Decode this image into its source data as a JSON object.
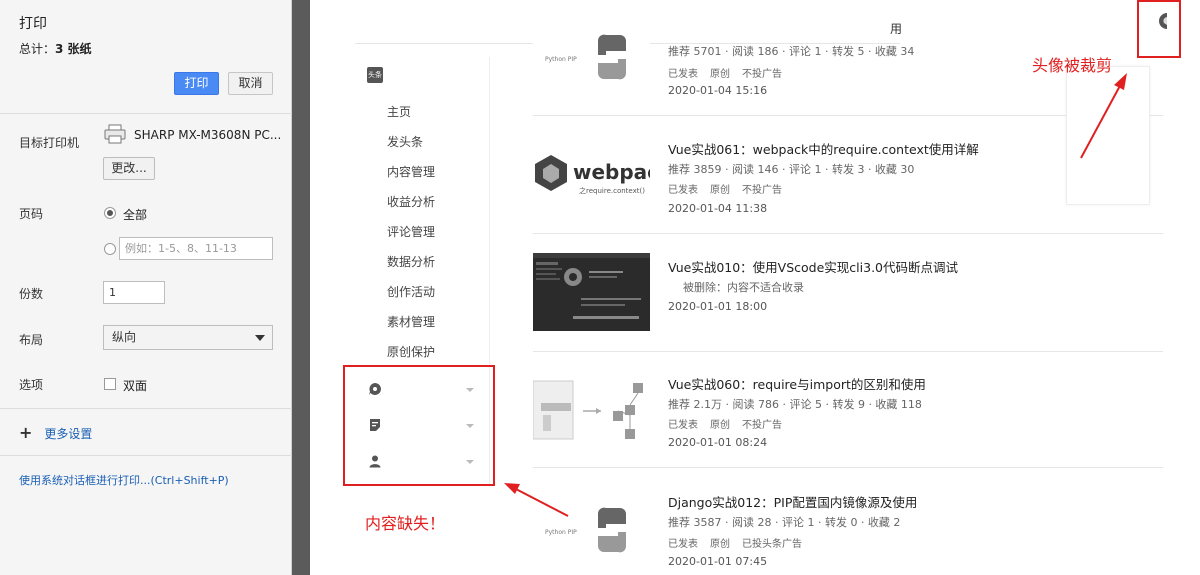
{
  "print_dialog": {
    "title": "打印",
    "total_label": "总计：",
    "total_value": "3 张纸",
    "print_button": "打印",
    "cancel_button": "取消",
    "destination_label": "目标打印机",
    "printer_name": "SHARP MX-M3608N PC...",
    "change_button": "更改...",
    "pages_label": "页码",
    "pages_all": "全部",
    "pages_custom_placeholder": "例如：1-5、8、11-13",
    "copies_label": "份数",
    "copies_value": "1",
    "layout_label": "布局",
    "layout_value": "纵向",
    "options_label": "选项",
    "duplex_label": "双面",
    "more_settings": "更多设置",
    "system_dialog": "使用系统对话框进行打印...(Ctrl+Shift+P)"
  },
  "preview": {
    "header_fragment": "用",
    "logo_badge": "头条",
    "sidebar_items": [
      "主页",
      "发头条",
      "内容管理",
      "收益分析",
      "评论管理",
      "数据分析",
      "创作活动",
      "素材管理",
      "原创保护"
    ],
    "sidebar_icons": [
      "bubble-icon",
      "document-icon",
      "user-icon"
    ],
    "articles": [
      {
        "title": "",
        "thumb_label": "Python PIP",
        "stats": "推荐 5701 · 阅读 186 · 评论 1 · 转发 5 · 收藏 34",
        "tags": [
          "已发表",
          "原创",
          "不投广告"
        ],
        "date": "2020-01-04 15:16"
      },
      {
        "title": "Vue实战061：webpack中的require.context使用详解",
        "thumb_label": "webpac",
        "thumb_sublabel": "之require.context()",
        "stats": "推荐 3859 · 阅读 146 · 评论 1 · 转发 3 · 收藏 30",
        "tags": [
          "已发表",
          "原创",
          "不投广告"
        ],
        "date": "2020-01-04 11:38"
      },
      {
        "title": "Vue实战010：使用VScode实现cli3.0代码断点调试",
        "deleted_note": "被删除：内容不适合收录",
        "date": "2020-01-01 18:00"
      },
      {
        "title": "Vue实战060：require与import的区别和使用",
        "stats": "推荐 2.1万 · 阅读 786 · 评论 5 · 转发 9 · 收藏 118",
        "tags": [
          "已发表",
          "原创",
          "不投广告"
        ],
        "date": "2020-01-01 08:24"
      },
      {
        "title": "Django实战012：PIP配置国内镜像源及使用",
        "thumb_label": "Python PIP",
        "stats": "推荐 3587 · 阅读 28 · 评论 1 · 转发 0 · 收藏 2",
        "tags": [
          "已发表",
          "原创",
          "已投头条广告"
        ],
        "date": "2020-01-01 07:45"
      }
    ]
  },
  "annotations": {
    "avatar_cropped": "头像被裁剪",
    "content_missing": "内容缺失！"
  },
  "colors": {
    "accent_blue": "#4a8af4",
    "annotation_red": "#e02020",
    "link_blue": "#1a5fb4"
  }
}
